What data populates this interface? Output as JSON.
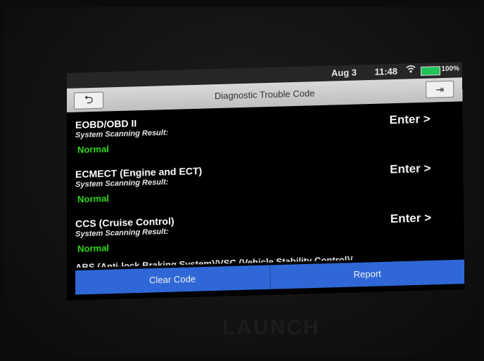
{
  "statusbar": {
    "date": "Aug 3",
    "time": "11:48",
    "battery": "100%",
    "wifi_icon": "wifi-icon",
    "battery_icon": "battery-icon"
  },
  "header": {
    "title": "Diagnostic Trouble Code",
    "back_icon": "back-arrow-icon",
    "exit_icon": "exit-icon"
  },
  "systems": [
    {
      "name": "EOBD/OBD II",
      "subtitle": "System Scanning Result:",
      "status": "Normal",
      "action": "Enter >"
    },
    {
      "name": "ECMECT (Engine and ECT)",
      "subtitle": "System Scanning Result:",
      "status": "Normal",
      "action": "Enter >"
    },
    {
      "name": "CCS (Cruise Control)",
      "subtitle": "System Scanning Result:",
      "status": "Normal",
      "action": "Enter >"
    }
  ],
  "partial_item": "ABS (Anti-lock Braking System)/VSC (Vehicle Stability Control)/",
  "footer": {
    "clear_label": "Clear Code",
    "report_label": "Report"
  },
  "device": {
    "brand": "LAUNCH"
  },
  "colors": {
    "status_ok": "#34d61c",
    "footer_bar": "#2f68d6",
    "battery": "#22c25a"
  }
}
